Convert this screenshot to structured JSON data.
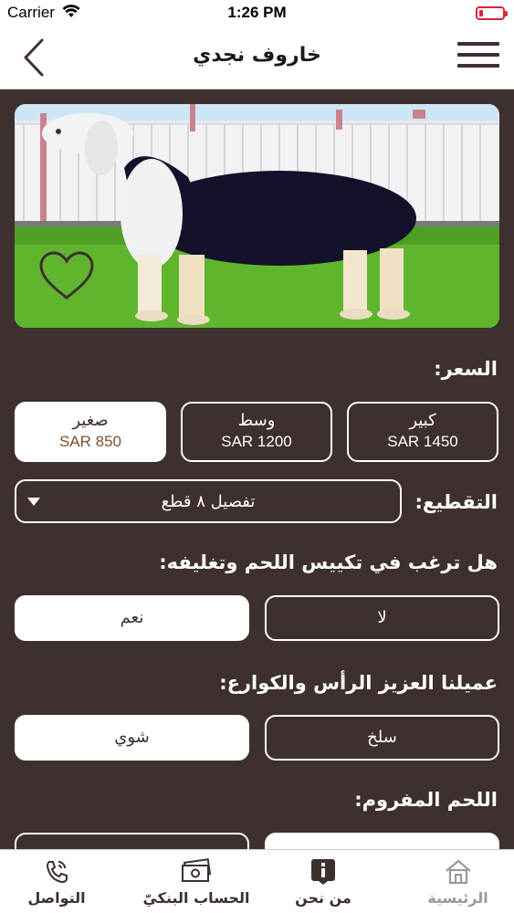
{
  "status_bar": {
    "carrier": "Carrier",
    "time": "1:26 PM"
  },
  "nav": {
    "title": "خاروف نجدي"
  },
  "price_section": {
    "label": "السعر:",
    "options": [
      {
        "name": "كبير",
        "price": "SAR 1450",
        "selected": false
      },
      {
        "name": "وسط",
        "price": "SAR 1200",
        "selected": false
      },
      {
        "name": "صغير",
        "price": "SAR 850",
        "selected": true
      }
    ]
  },
  "cutting": {
    "label": "التقطيع:",
    "value": "تفصيل ٨ قطع"
  },
  "packaging": {
    "label": "هل ترغب في تكييس اللحم وتغليفه:",
    "options": [
      {
        "label": "لا",
        "selected": false
      },
      {
        "label": "نعم",
        "selected": true
      }
    ]
  },
  "head_and_trotters": {
    "label": "عميلنا العزيز الرأس والكوارع:",
    "options": [
      {
        "label": "سلخ",
        "selected": false
      },
      {
        "label": "شوي",
        "selected": true
      }
    ]
  },
  "minced_meat": {
    "label": "اللحم المفروم:"
  },
  "tab_bar": {
    "items": [
      {
        "label": "الرئيسية",
        "icon": "home-icon",
        "active": false
      },
      {
        "label": "من نحن",
        "icon": "info-icon",
        "active": true
      },
      {
        "label": "الحساب البنكيّ",
        "icon": "banknote-icon",
        "active": true
      },
      {
        "label": "التواصل",
        "icon": "phone-icon",
        "active": true
      }
    ]
  },
  "colors": {
    "background": "#3d302e",
    "accent_price": "#7a5030",
    "battery": "#d9263a"
  }
}
